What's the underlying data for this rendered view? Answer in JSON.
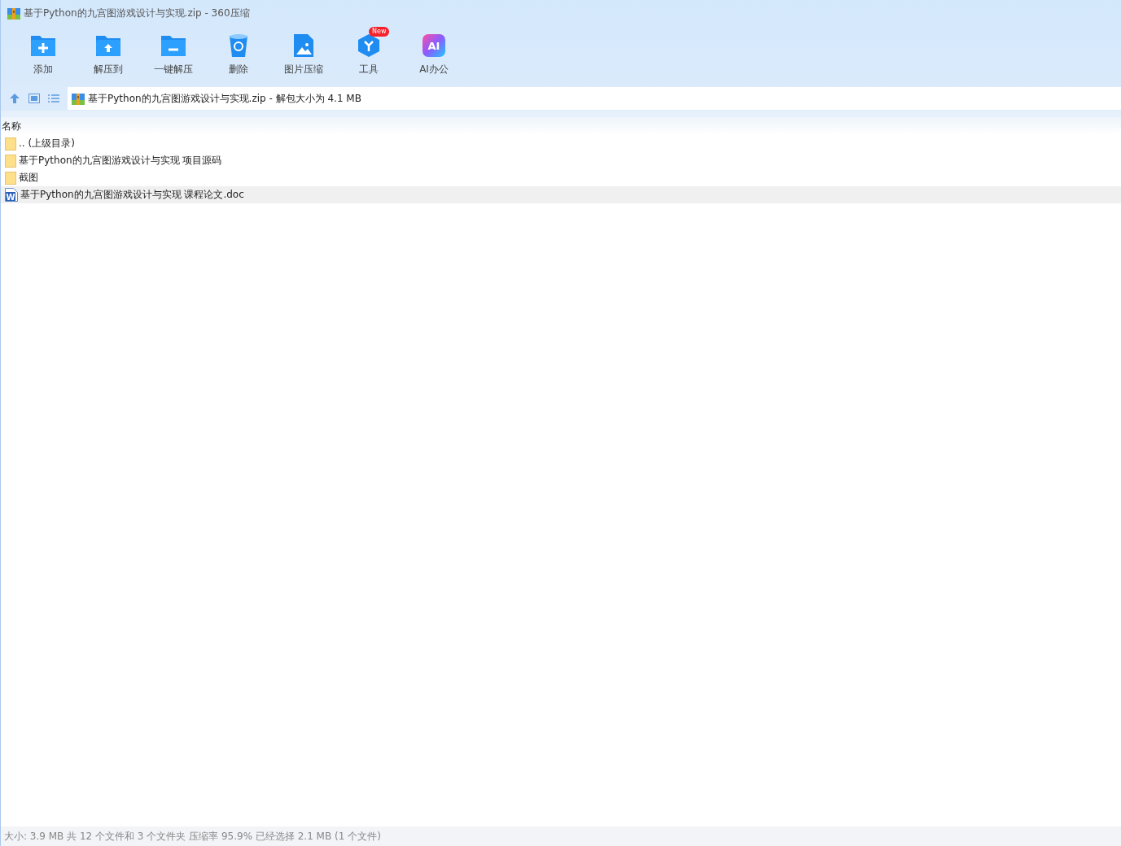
{
  "window": {
    "title": "基于Python的九宫图游戏设计与实现.zip - 360压缩"
  },
  "toolbar": [
    {
      "kind": "add",
      "label": "添加"
    },
    {
      "kind": "extract-to",
      "label": "解压到"
    },
    {
      "kind": "extract",
      "label": "一键解压"
    },
    {
      "kind": "delete",
      "label": "删除"
    },
    {
      "kind": "image",
      "label": "图片压缩"
    },
    {
      "kind": "tools",
      "label": "工具",
      "badge": "New"
    },
    {
      "kind": "ai",
      "label": "AI办公",
      "icon_text": "AI"
    }
  ],
  "address_bar": {
    "path": "基于Python的九宫图游戏设计与实现.zip - 解包大小为 4.1 MB"
  },
  "file_list": {
    "columns": [
      "名称"
    ],
    "rows": [
      {
        "kind": "folder",
        "name": ".. (上级目录)",
        "selected": false
      },
      {
        "kind": "folder",
        "name": "基于Python的九宫图游戏设计与实现 项目源码",
        "selected": false
      },
      {
        "kind": "folder",
        "name": "截图",
        "selected": false
      },
      {
        "kind": "doc",
        "name": "基于Python的九宫图游戏设计与实现 课程论文.doc",
        "doc_letter": "W",
        "selected": true
      }
    ]
  },
  "status_bar": "大小: 3.9 MB 共 12 个文件和 3 个文件夹 压缩率 95.9% 已经选择 2.1 MB (1 个文件)"
}
